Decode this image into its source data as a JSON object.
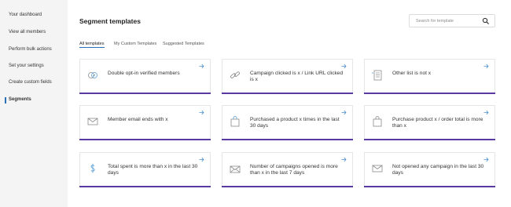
{
  "sidebar": {
    "items": [
      {
        "label": "Your dashboard"
      },
      {
        "label": "View all members"
      },
      {
        "label": "Perform bulk actions"
      },
      {
        "label": "Set your settings"
      },
      {
        "label": "Create custom fields"
      },
      {
        "label": "Segments",
        "active": true
      }
    ]
  },
  "header": {
    "title": "Segment templates"
  },
  "search": {
    "placeholder": "Search for template",
    "value": ""
  },
  "tabs": [
    {
      "label": "All templates",
      "active": true
    },
    {
      "label": "My Custom Templates",
      "active": false
    },
    {
      "label": "Suggested Templates",
      "active": false
    }
  ],
  "cards": [
    {
      "label": "Double opt-in verified members",
      "icon": "verified-icon"
    },
    {
      "label": "Campaign clicked is x / Link URL clicked is x",
      "icon": "link-icon"
    },
    {
      "label": "Other list is not x",
      "icon": "list-icon"
    },
    {
      "label": "Member email ends with x",
      "icon": "envelope-icon"
    },
    {
      "label": "Purchased a product x times in the last 30 days",
      "icon": "shopping-bag-icon"
    },
    {
      "label": "Purchase product x / order total is more than x",
      "icon": "shopping-bag-icon"
    },
    {
      "label": "Total spent is more than x in the last 30 days",
      "icon": "dollar-icon"
    },
    {
      "label": "Number of campaigns opened is more than x in the last 7 days",
      "icon": "open-envelope-icon"
    },
    {
      "label": "Not opened any campaign in the last 30 days",
      "icon": "envelope-x-icon"
    }
  ],
  "colors": {
    "accent": "#5a3aa0",
    "link": "#2a6fb8",
    "sidebar_bg": "#f4f4f4"
  }
}
